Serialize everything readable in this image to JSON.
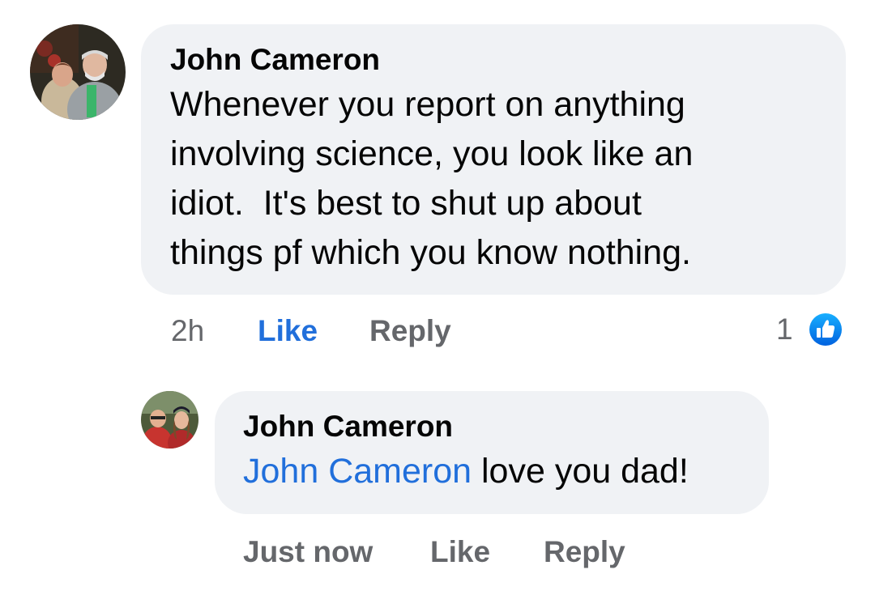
{
  "comments": [
    {
      "author": "John Cameron",
      "text_lines": [
        "Whenever you report on anything",
        "involving science, you look like an",
        "idiot.  It's best to shut up about",
        "things pf which you know nothing."
      ],
      "timestamp": "2h",
      "like_label": "Like",
      "reply_label": "Reply",
      "reaction_count": "1",
      "reaction_icon": "like-icon",
      "liked": true
    },
    {
      "author": "John Cameron",
      "mention": "John Cameron",
      "text": " love you dad!",
      "timestamp": "Just now",
      "like_label": "Like",
      "reply_label": "Reply"
    }
  ],
  "colors": {
    "bubble": "#f0f2f5",
    "link_blue": "#216fdb",
    "meta_gray": "#65676b",
    "text": "#050505"
  }
}
